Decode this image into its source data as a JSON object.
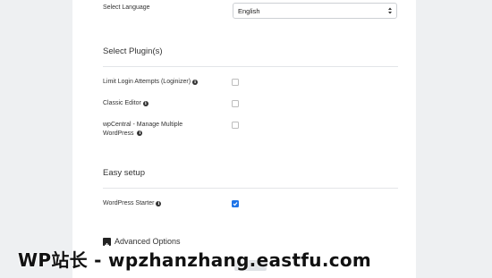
{
  "language": {
    "label": "Select Language",
    "selected": "English"
  },
  "plugins": {
    "title": "Select Plugin(s)",
    "items": [
      {
        "name": "Limit Login Attempts (Loginizer)",
        "checked": false
      },
      {
        "name": "Classic Editor",
        "checked": false
      },
      {
        "name_line1": "wpCentral - Manage Multiple",
        "name_line2": "WordPress",
        "checked": false
      }
    ]
  },
  "easy_setup": {
    "title": "Easy setup",
    "items": [
      {
        "name": "WordPress Starter",
        "checked": true
      }
    ]
  },
  "advanced": {
    "label": "Advanced Options"
  },
  "watermark": {
    "text": "WP站长 - wpzhanzhang.eastfu.com"
  },
  "colors": {
    "accent": "#1e74e8",
    "background": "#eef0f2",
    "panel": "#ffffff"
  }
}
